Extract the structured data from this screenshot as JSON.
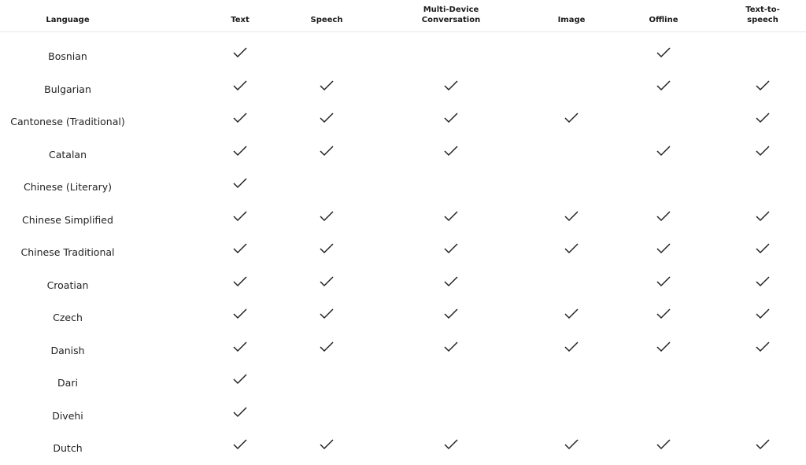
{
  "table": {
    "columns": [
      {
        "key": "language",
        "label": "Language"
      },
      {
        "key": "text",
        "label": "Text"
      },
      {
        "key": "speech",
        "label": "Speech"
      },
      {
        "key": "multi",
        "label": "Multi-Device\nConversation"
      },
      {
        "key": "image",
        "label": "Image"
      },
      {
        "key": "offline",
        "label": "Offline"
      },
      {
        "key": "tts",
        "label": "Text-to-\nspeech"
      }
    ],
    "rows": [
      {
        "language": "Bosnian",
        "text": true,
        "speech": false,
        "multi": false,
        "image": false,
        "offline": true,
        "tts": false
      },
      {
        "language": "Bulgarian",
        "text": true,
        "speech": true,
        "multi": true,
        "image": false,
        "offline": true,
        "tts": true
      },
      {
        "language": "Cantonese (Traditional)",
        "text": true,
        "speech": true,
        "multi": true,
        "image": true,
        "offline": false,
        "tts": true
      },
      {
        "language": "Catalan",
        "text": true,
        "speech": true,
        "multi": true,
        "image": false,
        "offline": true,
        "tts": true
      },
      {
        "language": "Chinese (Literary)",
        "text": true,
        "speech": false,
        "multi": false,
        "image": false,
        "offline": false,
        "tts": false
      },
      {
        "language": "Chinese Simplified",
        "text": true,
        "speech": true,
        "multi": true,
        "image": true,
        "offline": true,
        "tts": true
      },
      {
        "language": "Chinese Traditional",
        "text": true,
        "speech": true,
        "multi": true,
        "image": true,
        "offline": true,
        "tts": true
      },
      {
        "language": "Croatian",
        "text": true,
        "speech": true,
        "multi": true,
        "image": false,
        "offline": true,
        "tts": true
      },
      {
        "language": "Czech",
        "text": true,
        "speech": true,
        "multi": true,
        "image": true,
        "offline": true,
        "tts": true
      },
      {
        "language": "Danish",
        "text": true,
        "speech": true,
        "multi": true,
        "image": true,
        "offline": true,
        "tts": true
      },
      {
        "language": "Dari",
        "text": true,
        "speech": false,
        "multi": false,
        "image": false,
        "offline": false,
        "tts": false
      },
      {
        "language": "Divehi",
        "text": true,
        "speech": false,
        "multi": false,
        "image": false,
        "offline": false,
        "tts": false
      },
      {
        "language": "Dutch",
        "text": true,
        "speech": true,
        "multi": true,
        "image": true,
        "offline": true,
        "tts": true
      }
    ],
    "check_icon": "checkmark-icon",
    "check_color": "#222222"
  }
}
